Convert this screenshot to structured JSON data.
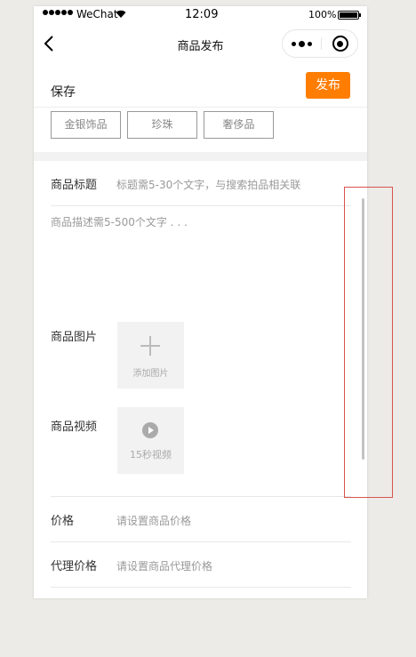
{
  "status_bar": {
    "carrier": "WeChat",
    "time": "12:09",
    "battery": "100%"
  },
  "nav": {
    "title": "商品发布"
  },
  "toolbar": {
    "save_label": "保存",
    "publish_label": "发布",
    "accent": "#ff7d00"
  },
  "categories": [
    "金银饰品",
    "珍珠",
    "奢侈品"
  ],
  "form": {
    "title_label": "商品标题",
    "title_placeholder": "标题需5-30个文字，与搜索拍品相关联",
    "description_placeholder": "商品描述需5-500个文字 . . .",
    "images_label": "商品图片",
    "add_image_label": "添加图片",
    "video_label": "商品视频",
    "video_caption": "15秒视频",
    "price_label": "价格",
    "price_placeholder": "请设置商品价格",
    "agent_price_label": "代理价格",
    "agent_price_placeholder": "请设置商品代理价格"
  }
}
